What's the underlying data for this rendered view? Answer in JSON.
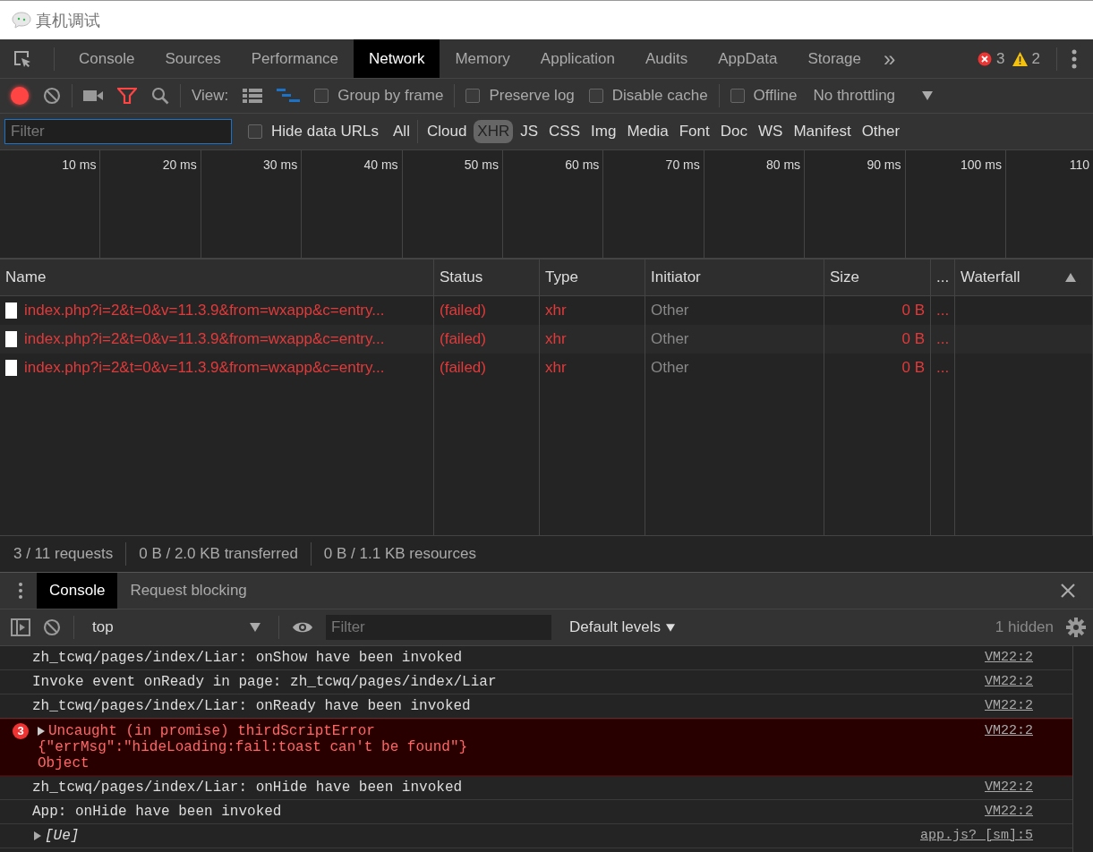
{
  "window": {
    "title": "真机调试"
  },
  "tabs": [
    {
      "label": "Console",
      "selected": false
    },
    {
      "label": "Sources",
      "selected": false
    },
    {
      "label": "Performance",
      "selected": false
    },
    {
      "label": "Network",
      "selected": true
    },
    {
      "label": "Memory",
      "selected": false
    },
    {
      "label": "Application",
      "selected": false
    },
    {
      "label": "Audits",
      "selected": false
    },
    {
      "label": "AppData",
      "selected": false
    },
    {
      "label": "Storage",
      "selected": false
    }
  ],
  "more_tabs": "»",
  "error_count": "3",
  "warning_count": "2",
  "network_toolbar": {
    "recording": true,
    "view_label": "View:",
    "checkboxes": [
      {
        "label": "Group by frame",
        "checked": false
      },
      {
        "label": "Preserve log",
        "checked": false
      },
      {
        "label": "Disable cache",
        "checked": false
      },
      {
        "label": "Offline",
        "checked": false
      }
    ],
    "throttling": "No throttling"
  },
  "filter_bar": {
    "placeholder": "Filter",
    "hide_data_urls": {
      "label": "Hide data URLs",
      "checked": false
    },
    "types": [
      {
        "label": "All",
        "selected": false
      },
      {
        "label": "Cloud",
        "selected": false
      },
      {
        "label": "XHR",
        "selected": true
      },
      {
        "label": "JS",
        "selected": false
      },
      {
        "label": "CSS",
        "selected": false
      },
      {
        "label": "Img",
        "selected": false
      },
      {
        "label": "Media",
        "selected": false
      },
      {
        "label": "Font",
        "selected": false
      },
      {
        "label": "Doc",
        "selected": false
      },
      {
        "label": "WS",
        "selected": false
      },
      {
        "label": "Manifest",
        "selected": false
      },
      {
        "label": "Other",
        "selected": false
      }
    ]
  },
  "timeline": {
    "ticks": [
      "10 ms",
      "20 ms",
      "30 ms",
      "40 ms",
      "50 ms",
      "60 ms",
      "70 ms",
      "80 ms",
      "90 ms",
      "100 ms",
      "110"
    ]
  },
  "table": {
    "columns": [
      "Name",
      "Status",
      "Type",
      "Initiator",
      "Size",
      "...",
      "Waterfall"
    ],
    "rows": [
      {
        "name": "index.php?i=2&t=0&v=11.3.9&from=wxapp&c=entry...",
        "status": "(failed)",
        "type": "xhr",
        "initiator": "Other",
        "size": "0 B",
        "column_6": "...",
        "failed": true
      },
      {
        "name": "index.php?i=2&t=0&v=11.3.9&from=wxapp&c=entry...",
        "status": "(failed)",
        "type": "xhr",
        "initiator": "Other",
        "size": "0 B",
        "column_6": "...",
        "failed": true
      },
      {
        "name": "index.php?i=2&t=0&v=11.3.9&from=wxapp&c=entry...",
        "status": "(failed)",
        "type": "xhr",
        "initiator": "Other",
        "size": "0 B",
        "column_6": "...",
        "failed": true
      }
    ]
  },
  "summary": [
    "3 / 11 requests",
    "0 B / 2.0 KB transferred",
    "0 B / 1.1 KB resources"
  ],
  "drawer_tabs": [
    {
      "label": "Console",
      "selected": true
    },
    {
      "label": "Request blocking",
      "selected": false
    }
  ],
  "console_toolbar": {
    "context": "top",
    "filter_placeholder": "Filter",
    "levels": "Default levels",
    "hidden": "1 hidden"
  },
  "messages": [
    {
      "kind": "log",
      "text": "zh_tcwq/pages/index/Liar: onShow have been invoked",
      "source": "VM22:2"
    },
    {
      "kind": "log",
      "text": "Invoke event onReady in page: zh_tcwq/pages/index/Liar",
      "source": "VM22:2"
    },
    {
      "kind": "log",
      "text": "zh_tcwq/pages/index/Liar: onReady have been invoked",
      "source": "VM22:2"
    },
    {
      "kind": "error",
      "count": "3",
      "lines": [
        "Uncaught (in promise) thirdScriptError",
        "{\"errMsg\":\"hideLoading:fail:toast can't be found\"}",
        "Object"
      ],
      "source": "VM22:2"
    },
    {
      "kind": "log",
      "text": "zh_tcwq/pages/index/Liar: onHide have been invoked",
      "source": "VM22:2"
    },
    {
      "kind": "log",
      "text": "App: onHide have been invoked",
      "source": "VM22:2"
    },
    {
      "kind": "object",
      "text": "[Ue]",
      "source": "app.js? [sm]:5"
    }
  ]
}
